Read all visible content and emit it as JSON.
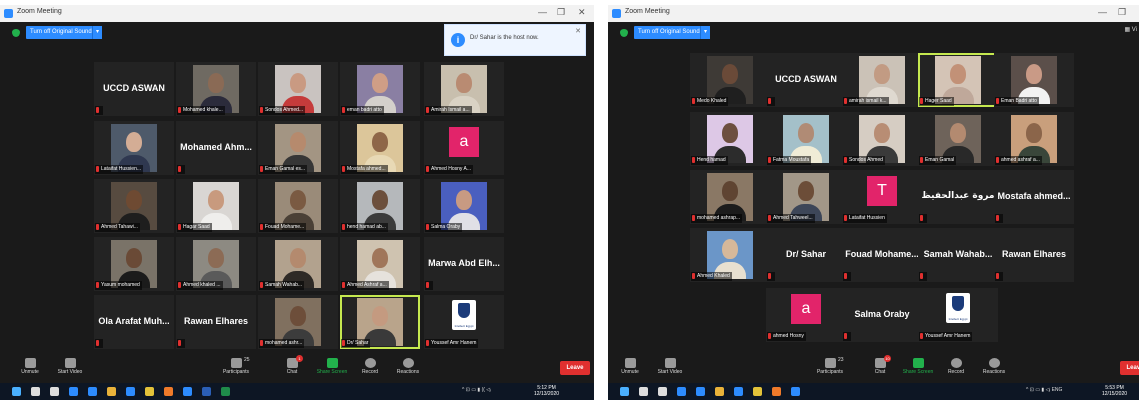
{
  "colors": {
    "accent": "#2d8cff",
    "active_speaker": "#c5e84f",
    "leave": "#e0302f",
    "mic_muted": "#e0302f",
    "share_green": "#22b14c"
  },
  "screens": [
    {
      "title": "Zoom Meeting",
      "sound_button": "Turn off Original Sound",
      "notification": "Dr/ Sahar is the host now.",
      "tiles": [
        {
          "kind": "name",
          "name": "UCCD ASWAN"
        },
        {
          "kind": "video",
          "label": "Mohamed khale...",
          "bg": "#6f6a62",
          "skin": "#8a6a55",
          "cloth": "#2b2b3b"
        },
        {
          "kind": "video",
          "label": "Sondos Ahmed...",
          "bg": "#c9c3c0",
          "skin": "#c99a82",
          "cloth": "#c53b3b"
        },
        {
          "kind": "video",
          "label": "eman badri atto",
          "bg": "#8a7fa3",
          "skin": "#cf9e86",
          "cloth": "#d4d0cb"
        },
        {
          "kind": "video",
          "label": "Amirah Ismail a...",
          "bg": "#c8bfae",
          "skin": "#b98b72",
          "cloth": "#d9d2c4"
        },
        {
          "kind": "video",
          "label": "Lataifat Hussien...",
          "bg": "#4e5a6a",
          "skin": "#d4ad95",
          "cloth": "#2f3850"
        },
        {
          "kind": "name",
          "name": "Mohamed  Ahm..."
        },
        {
          "kind": "video",
          "label": "Eman Gamal es...",
          "bg": "#a39583",
          "skin": "#b68a6d",
          "cloth": "#363636"
        },
        {
          "kind": "video",
          "label": "Mostafa ahmed...",
          "bg": "#dcc69a",
          "skin": "#8e6648",
          "cloth": "#e8d9b5"
        },
        {
          "kind": "avatar",
          "letter": "a",
          "bg": "#e2246a",
          "label": "Ahmed Hosny A..."
        },
        {
          "kind": "video",
          "label": "Ahmed Tahawi...",
          "bg": "#574b40",
          "skin": "#6e4a32",
          "cloth": "#1e1e1e"
        },
        {
          "kind": "video",
          "label": "Hagar Saad",
          "bg": "#d9d6d3",
          "skin": "#c89a7e",
          "cloth": "#efeeec"
        },
        {
          "kind": "video",
          "label": "Fouad Mohame...",
          "bg": "#9a8b79",
          "skin": "#7a5a42",
          "cloth": "#4a4036"
        },
        {
          "kind": "video",
          "label": "hend hamad ab...",
          "bg": "#b5b8bb",
          "skin": "#6c4f3c",
          "cloth": "#3b3b3b"
        },
        {
          "kind": "video",
          "label": "Salma Oraby",
          "bg": "#4a5fbf",
          "skin": "#c89a82",
          "cloth": "#e0e0e6"
        },
        {
          "kind": "video",
          "label": "Yasum mohamed",
          "bg": "#7a7368",
          "skin": "#6a4a36",
          "cloth": "#1b1b1b"
        },
        {
          "kind": "video",
          "label": "Ahmed khaled ...",
          "bg": "#8d8a82",
          "skin": "#8c6b55",
          "cloth": "#5a5a5a"
        },
        {
          "kind": "video",
          "label": "Samah Wahab...",
          "bg": "#b2a28e",
          "skin": "#b48a6e",
          "cloth": "#2e2a26"
        },
        {
          "kind": "video",
          "label": "Ahmed Ashraf a...",
          "bg": "#cfc3b0",
          "skin": "#a0765a",
          "cloth": "#e6e2dc"
        },
        {
          "kind": "name",
          "name": "Marwa  Abd  Elh..."
        },
        {
          "kind": "name",
          "name": "Ola Arafat  Muh..."
        },
        {
          "kind": "name",
          "name": "Rawan  Elhares"
        },
        {
          "kind": "video",
          "label": "mohamed ashr...",
          "bg": "#80705f",
          "skin": "#6d4e3a",
          "cloth": "#3c3c3c"
        },
        {
          "kind": "video",
          "label": "Dr/ Sahar",
          "bg": "#b9a48b",
          "skin": "#c49a80",
          "cloth": "#3a3a3a",
          "active": true
        },
        {
          "kind": "logo",
          "label": "Youssef Amr Hanem",
          "logo_text": "Intellect Egypt"
        }
      ],
      "toolbar": {
        "unmute": "Unmute",
        "start_video": "Start Video",
        "participants": "Participants",
        "participant_count": "25",
        "chat": "Chat",
        "chat_badge": "1",
        "share": "Share Screen",
        "record": "Record",
        "reactions": "Reactions",
        "leave": "Leave"
      },
      "clock_time": "5:12 PM",
      "clock_date": "12/13/2020",
      "tray_text": "^ ⊡ ▭ ▮ (( ◁ᵢ"
    },
    {
      "title": "Zoom Meeting",
      "sound_button": "Turn off Original Sound",
      "view_button": "▦ Vi",
      "tiles": [
        {
          "kind": "video",
          "label": "Medo Khaled",
          "bg": "#3e3a36",
          "skin": "#6a4a38",
          "cloth": "#1f1f1f"
        },
        {
          "kind": "name",
          "name": "UCCD ASWAN"
        },
        {
          "kind": "video",
          "label": "amirah ismail k...",
          "bg": "#cbc2b7",
          "skin": "#c29b83",
          "cloth": "#dfd9d0"
        },
        {
          "kind": "video",
          "label": "Hager Saad",
          "bg": "#d4c4b6",
          "skin": "#c29177",
          "cloth": "#bfa89a",
          "active": true
        },
        {
          "kind": "video",
          "label": "Eman Badri atto",
          "bg": "#5b4f4a",
          "skin": "#c99a86",
          "cloth": "#f2f2f2"
        },
        {
          "kind": "video",
          "label": "Hend hamad",
          "bg": "#ddc8e6",
          "skin": "#6d4f3f",
          "cloth": "#2c2c2c"
        },
        {
          "kind": "video",
          "label": "Fatma Moustafa",
          "bg": "#a4c0c9",
          "skin": "#b08b75",
          "cloth": "#f0ecd6"
        },
        {
          "kind": "video",
          "label": "Sondos Ahmed",
          "bg": "#d6cdc3",
          "skin": "#b88d74",
          "cloth": "#3a3a3a"
        },
        {
          "kind": "video",
          "label": "Eman Gamal",
          "bg": "#6e635a",
          "skin": "#b38a70",
          "cloth": "#292929"
        },
        {
          "kind": "video",
          "label": "ahmed ashraf a...",
          "bg": "#c99f7c",
          "skin": "#8b654a",
          "cloth": "#39463a"
        },
        {
          "kind": "video",
          "label": "mohamed ashrap...",
          "bg": "#8a7865",
          "skin": "#5f4432",
          "cloth": "#1c1c1c"
        },
        {
          "kind": "video",
          "label": "Ahmed Tahweel...",
          "bg": "#a29788",
          "skin": "#6c4d38",
          "cloth": "#3d4658"
        },
        {
          "kind": "avatar",
          "letter": "T",
          "bg": "#e2246a",
          "label": "Lataifat Hussien"
        },
        {
          "kind": "name",
          "name": "مروة عبدالحفيظ",
          "ar": true
        },
        {
          "kind": "name",
          "name": "Mostafa  ahmed..."
        },
        {
          "kind": "video",
          "label": "Ahmed Khaled",
          "bg": "#6b96c8",
          "skin": "#d6b89a",
          "cloth": "#e8e0d0"
        },
        {
          "kind": "name",
          "name": "Dr/ Sahar"
        },
        {
          "kind": "name",
          "name": "Fouad  Mohame..."
        },
        {
          "kind": "name",
          "name": "Samah  Wahab..."
        },
        {
          "kind": "name",
          "name": "Rawan  Elhares"
        },
        {
          "kind": "avatar",
          "letter": "a",
          "bg": "#e2246a",
          "label": "ahmed Hosny"
        },
        {
          "kind": "name",
          "name": "Salma  Oraby"
        },
        {
          "kind": "logo",
          "label": "Youssef Amr Hanem",
          "logo_text": "Intellect Egypt"
        }
      ],
      "toolbar": {
        "unmute": "Unmute",
        "start_video": "Start Video",
        "participants": "Participants",
        "participant_count": "23",
        "chat": "Chat",
        "chat_badge": "10",
        "share": "Share Screen",
        "record": "Record",
        "reactions": "Reactions",
        "leave": "Leave"
      },
      "clock_time": "5:53 PM",
      "clock_date": "12/15/2020",
      "tray_text": "^ ⊡ ▭ ▮ ◁ᵢ ENG"
    }
  ]
}
